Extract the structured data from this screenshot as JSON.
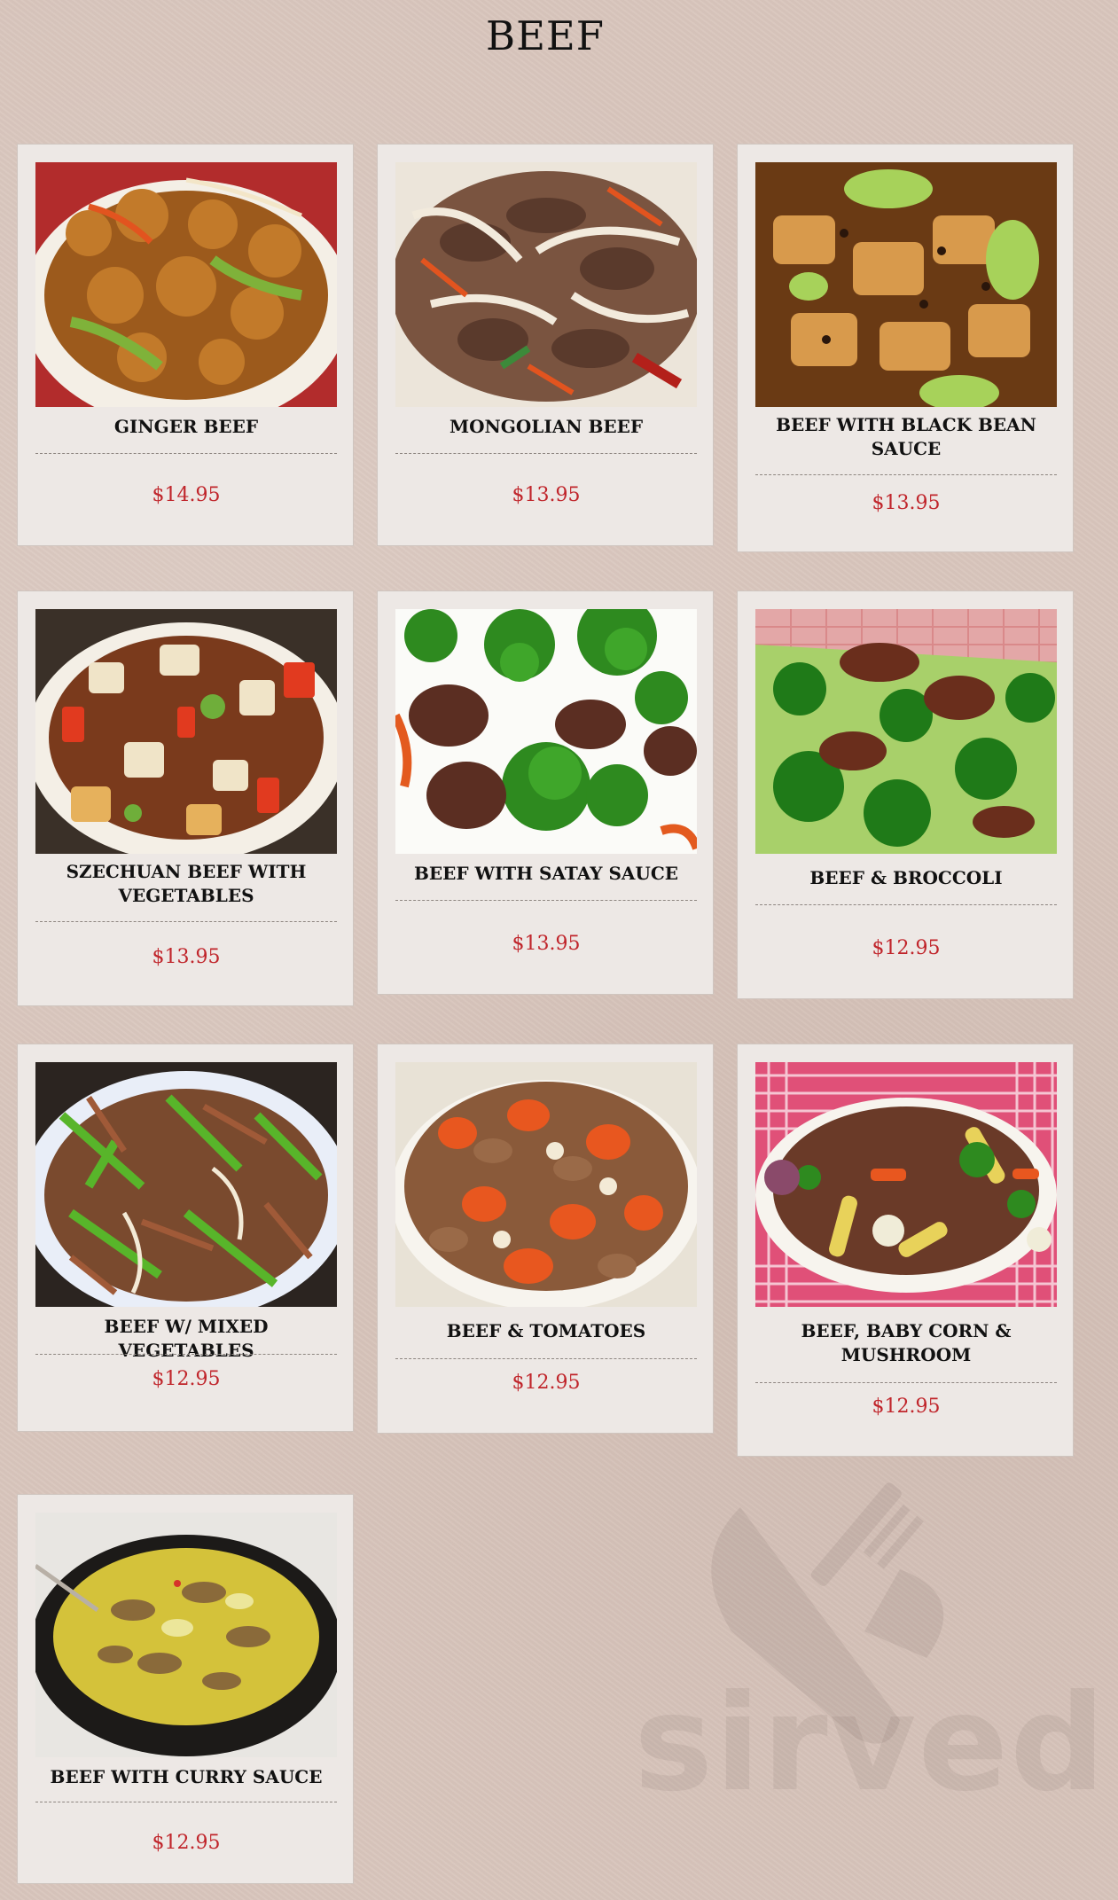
{
  "page": {
    "title": "BEEF"
  },
  "items": [
    {
      "name": "GINGER BEEF",
      "price": "$14.95",
      "image_icon": "ginger-beef-photo"
    },
    {
      "name": "MONGOLIAN BEEF",
      "price": "$13.95",
      "image_icon": "mongolian-beef-photo"
    },
    {
      "name": "BEEF WITH BLACK BEAN SAUCE",
      "price": "$13.95",
      "image_icon": "black-bean-beef-photo"
    },
    {
      "name": "SZECHUAN BEEF WITH VEGETABLES",
      "price": "$13.95",
      "image_icon": "szechuan-beef-photo"
    },
    {
      "name": "BEEF WITH SATAY SAUCE",
      "price": "$13.95",
      "image_icon": "satay-beef-photo"
    },
    {
      "name": "BEEF & BROCCOLI",
      "price": "$12.95",
      "image_icon": "beef-broccoli-photo"
    },
    {
      "name": "BEEF W/ MIXED VEGETABLES",
      "price": "$12.95",
      "image_icon": "mixed-vegetables-beef-photo"
    },
    {
      "name": "BEEF & TOMATOES",
      "price": "$12.95",
      "image_icon": "beef-tomatoes-photo"
    },
    {
      "name": "BEEF, BABY CORN & MUSHROOM",
      "price": "$12.95",
      "image_icon": "baby-corn-beef-photo"
    },
    {
      "name": "BEEF WITH CURRY SAUCE",
      "price": "$12.95",
      "image_icon": "curry-beef-photo"
    }
  ],
  "watermark": {
    "text": "sirved",
    "icon": "knife-fork-icon"
  },
  "colors": {
    "price": "#c0252b",
    "card": "#ede8e5",
    "background": "#d9c6bd"
  }
}
